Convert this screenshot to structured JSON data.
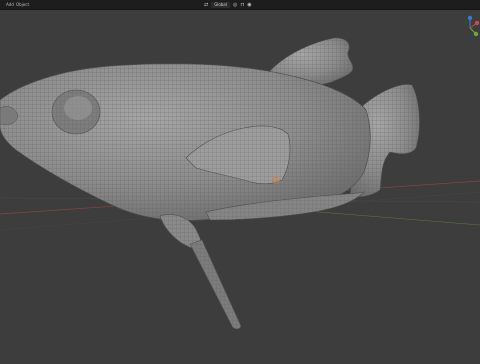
{
  "header": {
    "menu": [
      "Add",
      "Object"
    ],
    "orientation_label": "Global"
  },
  "colors": {
    "background": "#3d3d3d",
    "header": "#1d1d1d",
    "mesh_fill": "#8e8e8e",
    "wire": "#5f5f5f",
    "x_axis": "#c84b4b",
    "y_axis": "#6fa83a",
    "z_axis": "#3a78d8",
    "origin": "#e07a2f"
  },
  "icons": [
    "transform-orientation-icon",
    "pivot-icon",
    "snap-icon",
    "proportional-edit-icon",
    "gizmo-x-icon",
    "gizmo-y-icon",
    "gizmo-z-icon",
    "object-origin-icon"
  ],
  "viewport": {
    "object": "fish-mesh",
    "mode": "object-mode",
    "wireframe_overlay": true
  }
}
